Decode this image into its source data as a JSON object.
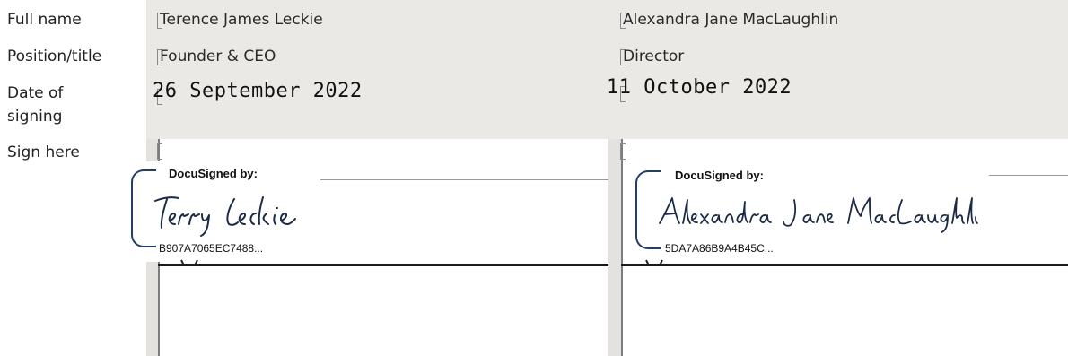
{
  "labels": {
    "full_name": "Full name",
    "position": "Position/title",
    "date_line1": "Date of",
    "date_line2": "signing",
    "sign_here": "Sign here"
  },
  "signers": [
    {
      "full_name": "Terence James Leckie",
      "position": "Founder & CEO",
      "date": "26 September 2022",
      "docusign_header": "DocuSigned by:",
      "signature": "Terry Leckie",
      "envelope_id": "B907A7065EC7488..."
    },
    {
      "full_name": "Alexandra Jane MacLaughlin",
      "position": "Director",
      "date": "11 October 2022",
      "docusign_header": "DocuSigned by:",
      "signature": "Alexandra Jane MacLaughlin",
      "envelope_id": "5DA7A86B9A4B45C..."
    }
  ],
  "colors": {
    "field_shade": "#ebe9e5",
    "docusign_bracket": "#1f3f73",
    "signature_ink": "#1a2a4a"
  }
}
